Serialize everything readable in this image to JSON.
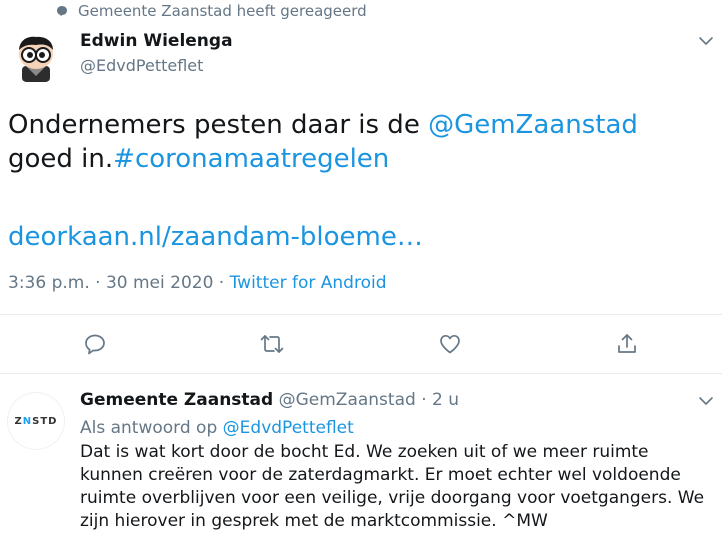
{
  "social_context": {
    "text": "Gemeente Zaanstad heeft gereageerd"
  },
  "tweet": {
    "author_name": "Edwin Wielenga",
    "author_handle": "@EdvdPetteflet",
    "text_1": "Ondernemers pesten daar is de ",
    "mention": "@GemZaanstad",
    "text_2": " goed in.",
    "hashtag": "#coronamaatregelen",
    "link_text": "deorkaan.nl/zaandam-bloeme…",
    "time": "3:36 p.m. · 30 mei 2020 · ",
    "source": "Twitter for Android"
  },
  "actions": [
    "reply-icon",
    "retweet-icon",
    "like-icon",
    "share-icon"
  ],
  "reply": {
    "avatar_text": {
      "prefix": "Z",
      "n": "N",
      "suffix": "STD"
    },
    "author_name": "Gemeente Zaanstad",
    "author_handle": "@GemZaanstad",
    "time": " · 2 u",
    "reply_prefix": "Als antwoord op ",
    "reply_to": "@EdvdPetteflet",
    "text": "Dat is wat kort door de bocht Ed. We zoeken uit of we meer ruimte kunnen creëren voor de zaterdagmarkt. Er moet echter wel voldoende ruimte overblijven voor een veilige, vrije doorgang voor voetgangers. We zijn hierover in gesprek met de marktcommissie. ^MW"
  },
  "colors": {
    "link": "#1b95e0",
    "muted": "#657786",
    "text": "#14171a",
    "divider": "#e6ecf0"
  }
}
